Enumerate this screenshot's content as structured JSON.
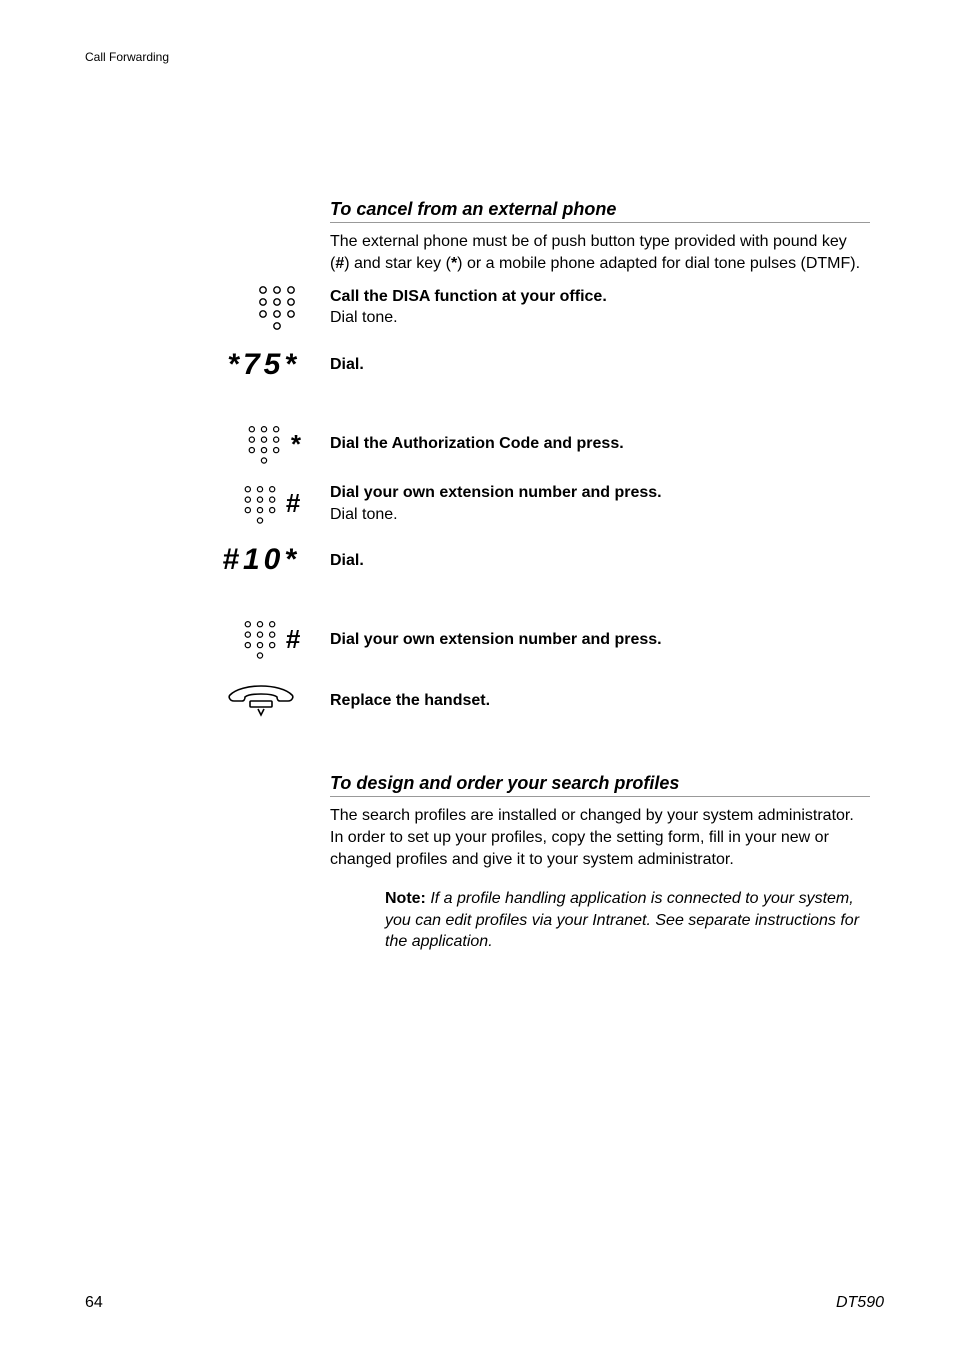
{
  "header": {
    "section": "Call Forwarding"
  },
  "section1": {
    "title": "To cancel from an external phone",
    "intro_pre": "The external phone must be of push button type provided with pound key (",
    "intro_mid": ") and star key (",
    "intro_post": ") or a mobile phone adapted for dial tone pulses (DTMF).",
    "hash": "#",
    "star": "*"
  },
  "steps": {
    "s1": {
      "bold": "Call the DISA function at your office.",
      "sub": "Dial tone."
    },
    "s2": {
      "code": "*75*",
      "bold": "Dial."
    },
    "s3": {
      "bold": "Dial the Authorization Code and press."
    },
    "s4": {
      "bold": "Dial your own extension number and press.",
      "sub": "Dial tone."
    },
    "s5": {
      "code": "#10*",
      "bold": "Dial."
    },
    "s6": {
      "bold": "Dial your own extension number and press."
    },
    "s7": {
      "bold": "Replace the handset."
    }
  },
  "section2": {
    "title": "To design and order your search profiles",
    "body": "The search profiles are installed or changed by your system administrator. In order to set up your profiles, copy the setting form, fill in your new or changed profiles and give it to your system administrator.",
    "note_label": "Note:",
    "note_body": "  If a profile handling application is connected to your system, you can edit profiles via your Intranet. See separate instructions for the application."
  },
  "footer": {
    "page": "64",
    "model": "DT590"
  }
}
